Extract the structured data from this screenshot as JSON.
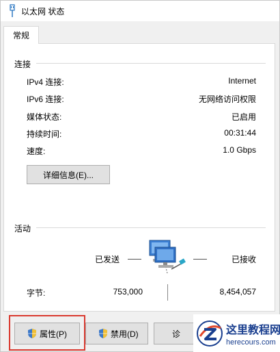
{
  "window": {
    "title": "以太网 状态",
    "title_icon": "ethernet-cable-icon"
  },
  "tabs": [
    {
      "label": "常规",
      "active": true
    }
  ],
  "connection": {
    "section_label": "连接",
    "rows": [
      {
        "label": "IPv4 连接:",
        "value": "Internet"
      },
      {
        "label": "IPv6 连接:",
        "value": "无网络访问权限"
      },
      {
        "label": "媒体状态:",
        "value": "已启用"
      },
      {
        "label": "持续时间:",
        "value": "00:31:44"
      },
      {
        "label": "速度:",
        "value": "1.0 Gbps"
      }
    ],
    "details_button": "详细信息(E)..."
  },
  "activity": {
    "section_label": "活动",
    "sent_label": "已发送",
    "received_label": "已接收",
    "network_icon": "network-computer-icon",
    "bytes_label": "字节:",
    "bytes_sent": "753,000",
    "bytes_received": "8,454,057"
  },
  "buttons": {
    "properties": "属性(P)",
    "disable": "禁用(D)",
    "diagnose": "诊"
  },
  "watermark": {
    "name": "这里教程网",
    "url": "herecours.com"
  },
  "colors": {
    "highlight": "#d9382e",
    "brand": "#1a3f8f"
  }
}
